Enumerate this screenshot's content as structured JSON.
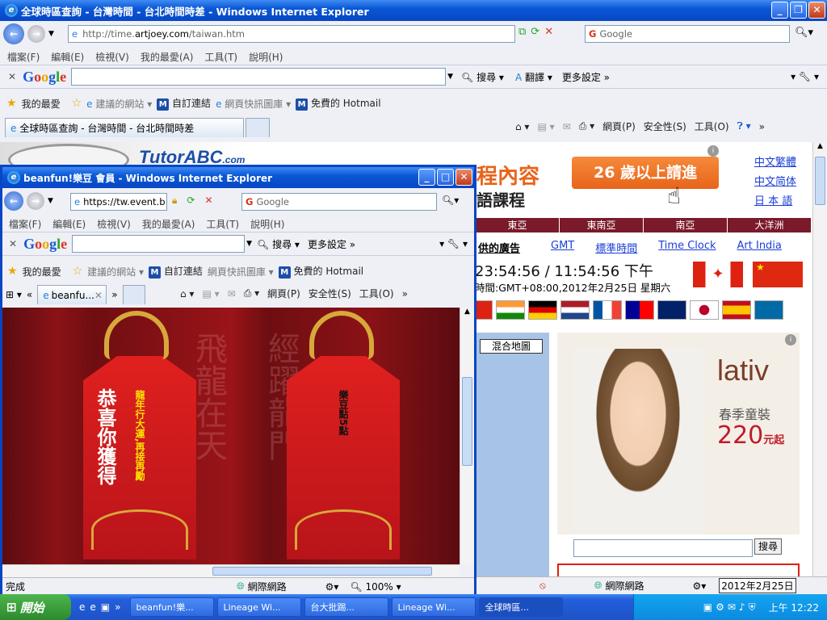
{
  "main_window": {
    "title": "全球時區查詢 - 台灣時間 - 台北時間時差 - Windows Internet Explorer",
    "url_host": "http://time.",
    "url_domain": "artjoey.com",
    "url_path": "/taiwan.htm",
    "search_placeholder": "Google",
    "menu": [
      "檔案(F)",
      "編輯(E)",
      "檢視(V)",
      "我的最愛(A)",
      "工具(T)",
      "說明(H)"
    ],
    "toolbar_search": "搜尋",
    "toolbar_translate": "翻譯",
    "toolbar_more": "更多設定",
    "favorites": {
      "label": "我的最愛",
      "items": [
        "建議的網站",
        "自訂連結",
        "網頁快訊圖庫",
        "免費的 Hotmail"
      ]
    },
    "tab_label": "全球時區查詢 - 台灣時間 - 台北時間時差",
    "cmd": [
      "網頁(P)",
      "安全性(S)",
      "工具(O)"
    ],
    "status_zone": "網際網路",
    "status_date": "2012年2月25日"
  },
  "page": {
    "tutor_brand": "TutorABC",
    "tutor_suffix": ".com",
    "ad_title": "程內容",
    "ad_sub": "語課程",
    "ad_button": "26 歲以上請進",
    "lang_links": [
      "中文繁體",
      "中文简体",
      "日 本 語"
    ],
    "regions": [
      "東亞",
      "東南亞",
      "南亞",
      "大洋洲"
    ],
    "sponsor": "供的廣告",
    "nav_links": [
      "GMT",
      "標準時間",
      "Time Clock",
      "Art India"
    ],
    "clock": "23:54:56 / 11:54:56 下午",
    "clock_info": "時間:GMT+08:00,2012年2月25日 星期六",
    "map_button": "混合地圖",
    "lativ_brand": "lativ",
    "lativ_line1": "春季童裝",
    "lativ_price": "220",
    "lativ_unit": "元起",
    "search_button": "搜尋"
  },
  "popup": {
    "title": "beanfun!樂豆 會員 - Windows Internet Explorer",
    "url": "https://tw.event.b",
    "search_placeholder": "Google",
    "menu": [
      "檔案(F)",
      "編輯(E)",
      "檢視(V)",
      "我的最愛(A)",
      "工具(T)",
      "說明(H)"
    ],
    "toolbar_search": "搜尋",
    "toolbar_more": "更多設定",
    "favorites": {
      "label": "我的最愛",
      "items": [
        "建議的網站",
        "自訂連結",
        "網頁快訊圖庫",
        "免費的 Hotmail"
      ]
    },
    "tab_label": "beanfu...",
    "cmd": [
      "網頁(P)",
      "安全性(S)",
      "工具(O)"
    ],
    "status_left": "完成",
    "status_zone": "網際網路",
    "zoom": "100%",
    "tag_left_main": "恭喜你獲得",
    "tag_left_sub": "龍年行大運,再接再勵",
    "tag_right": "樂豆點5點",
    "bg_text_1": "飛龍在天",
    "bg_text_2": "經躍龍門"
  },
  "taskbar": {
    "start": "開始",
    "buttons": [
      "beanfun!樂...",
      "Lineage Wi...",
      "台大批踢...",
      "Lineage Wi...",
      "全球時區..."
    ],
    "clock": "上午 12:22"
  },
  "colors": {
    "xp_blue": "#0a58d6",
    "banner_orange": "#e8641a",
    "region_bar": "#7a1a2a",
    "popup_red": "#9a1418"
  }
}
